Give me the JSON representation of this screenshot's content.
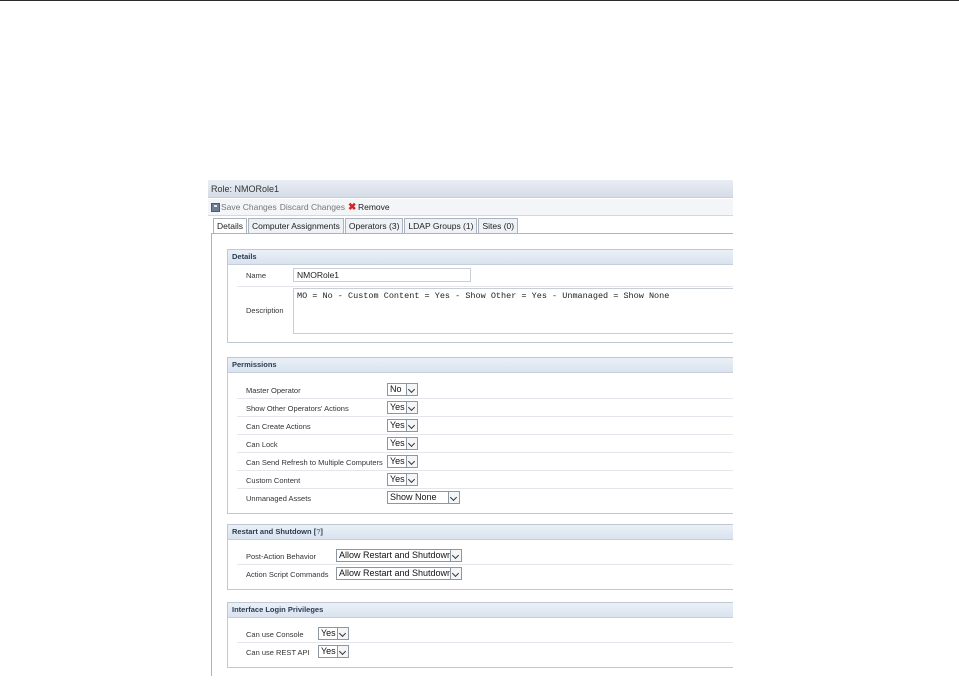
{
  "window": {
    "title": "Role: NMORole1"
  },
  "toolbar": {
    "save_label": "Save Changes",
    "discard_label": "Discard Changes",
    "remove_label": "Remove"
  },
  "tabs": [
    {
      "label": "Details"
    },
    {
      "label": "Computer Assignments"
    },
    {
      "label": "Operators (3)"
    },
    {
      "label": "LDAP Groups (1)"
    },
    {
      "label": "Sites (0)"
    }
  ],
  "details": {
    "header": "Details",
    "name_label": "Name",
    "name_value": "NMORole1",
    "description_label": "Description",
    "description_value": "MO = No - Custom Content = Yes - Show Other = Yes - Unmanaged = Show None"
  },
  "permissions": {
    "header": "Permissions",
    "rows": [
      {
        "label": "Master Operator",
        "value": "No"
      },
      {
        "label": "Show Other Operators' Actions",
        "value": "Yes"
      },
      {
        "label": "Can Create Actions",
        "value": "Yes"
      },
      {
        "label": "Can Lock",
        "value": "Yes"
      },
      {
        "label": "Can Send Refresh to Multiple Computers",
        "value": "Yes"
      },
      {
        "label": "Custom Content",
        "value": "Yes"
      },
      {
        "label": "Unmanaged Assets",
        "value": "Show None"
      }
    ]
  },
  "restart": {
    "header": "Restart and Shutdown",
    "help_open": "[",
    "help_link": "?",
    "help_close": "]",
    "rows": [
      {
        "label": "Post-Action Behavior",
        "value": "Allow Restart and Shutdown"
      },
      {
        "label": "Action Script Commands",
        "value": "Allow Restart and Shutdown"
      }
    ]
  },
  "login": {
    "header": "Interface Login Privileges",
    "rows": [
      {
        "label": "Can use Console",
        "value": "Yes"
      },
      {
        "label": "Can use REST API",
        "value": "Yes"
      }
    ]
  }
}
